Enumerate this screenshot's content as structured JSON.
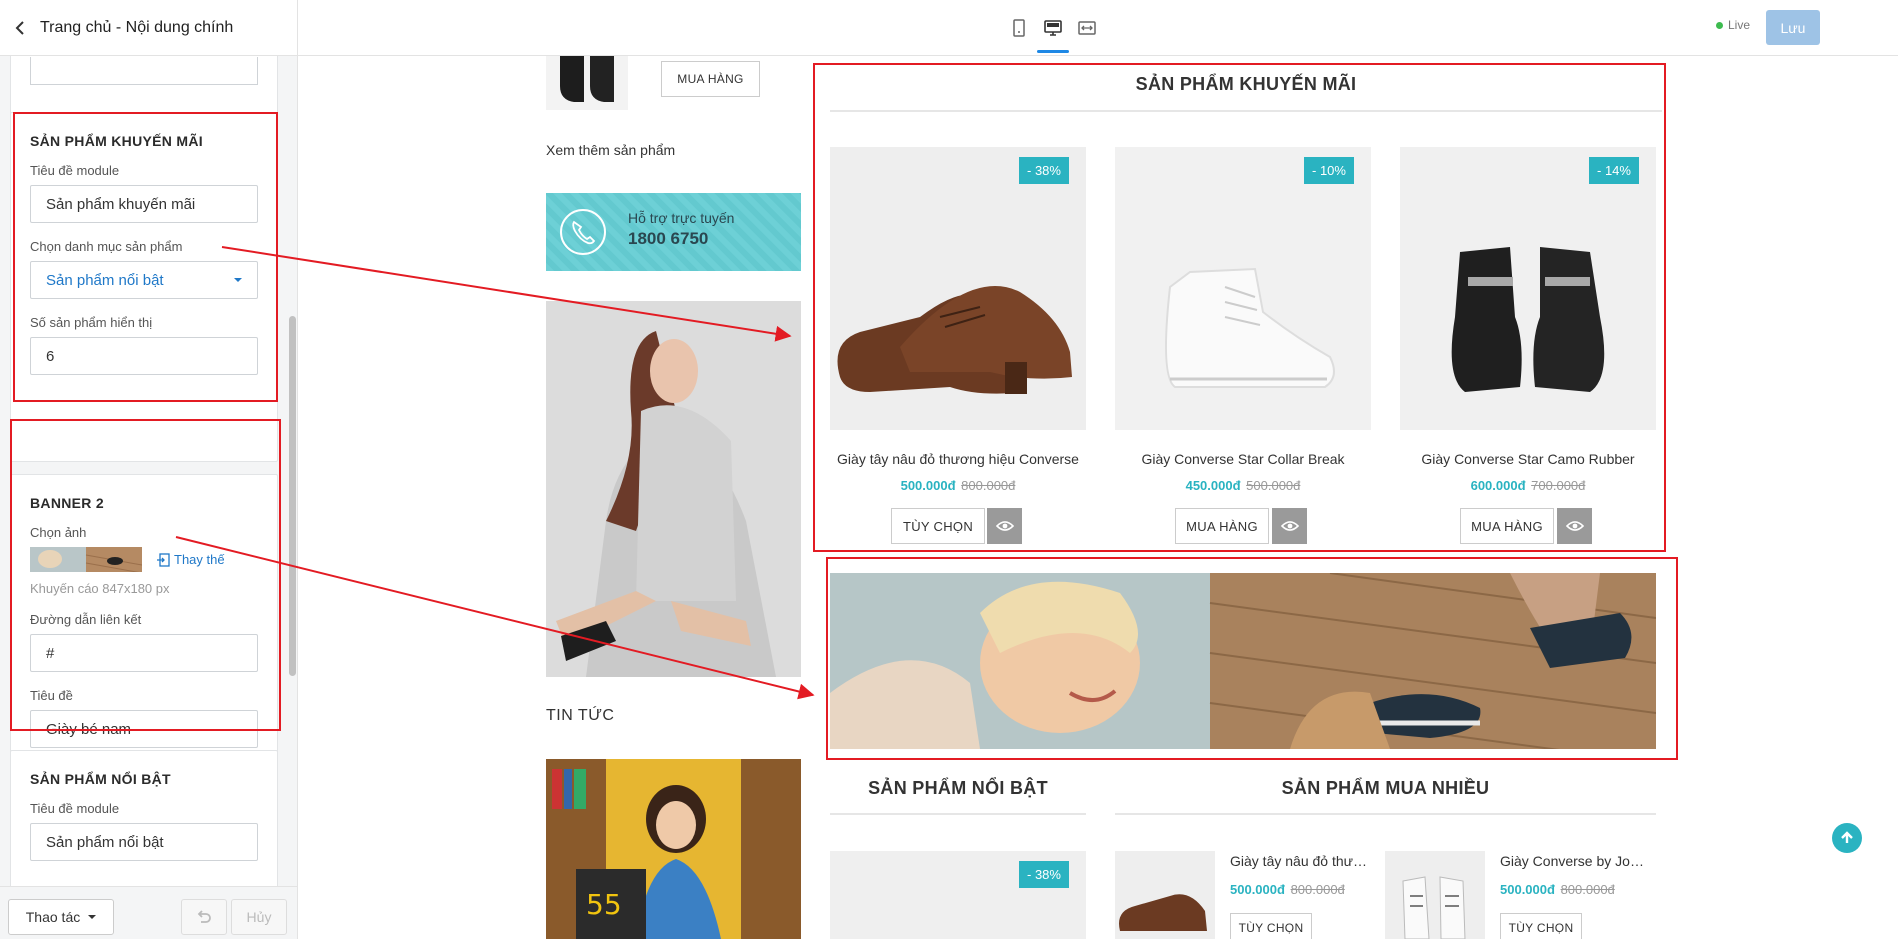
{
  "header": {
    "title": "Trang chủ - Nội dung chính",
    "live_label": "Live",
    "save_label": "Lưu"
  },
  "sidebar": {
    "promo": {
      "heading": "SẢN PHẨM KHUYẾN MÃI",
      "module_title_label": "Tiêu đề module",
      "module_title_value": "Sản phẩm khuyến mãi",
      "category_label": "Chọn danh mục sản phẩm",
      "category_value": "Sản phẩm nổi bật",
      "count_label": "Số sản phẩm hiển thị",
      "count_value": "6"
    },
    "banner": {
      "heading": "BANNER 2",
      "image_label": "Chọn ảnh",
      "replace_label": "Thay thế",
      "hint": "Khuyến cáo 847x180 px",
      "link_label": "Đường dẫn liên kết",
      "link_value": "#",
      "title_label": "Tiêu đề",
      "title_value": "Giày bé nam"
    },
    "featured": {
      "heading": "SẢN PHẨM NỔI BẬT",
      "module_title_label": "Tiêu đề module",
      "module_title_value": "Sản phẩm nổi bật"
    },
    "footer": {
      "actions_label": "Thao tác",
      "cancel_label": "Hủy"
    }
  },
  "preview": {
    "left": {
      "buy_label": "MUA HÀNG",
      "see_more": "Xem thêm sản phẩm",
      "support_label": "Hỗ trợ trực tuyến",
      "support_phone": "1800 6750",
      "news_heading": "TIN TỨC"
    },
    "promo": {
      "title": "SẢN PHẨM KHUYẾN MÃI",
      "products": [
        {
          "name": "Giày tây nâu đỏ thương hiệu Converse",
          "price": "500.000đ",
          "old_price": "800.000đ",
          "badge": "- 38%",
          "button": "TÙY CHỌN"
        },
        {
          "name": "Giày Converse Star Collar Break",
          "price": "450.000đ",
          "old_price": "500.000đ",
          "badge": "- 10%",
          "button": "MUA HÀNG"
        },
        {
          "name": "Giày Converse Star Camo Rubber",
          "price": "600.000đ",
          "old_price": "700.000đ",
          "badge": "- 14%",
          "button": "MUA HÀNG"
        }
      ]
    },
    "featured": {
      "title": "SẢN PHẨM NỔI BẬT",
      "badge": "- 38%"
    },
    "bestseller": {
      "title": "SẢN PHẨM MUA NHIỀU",
      "products": [
        {
          "name": "Giày tây nâu đỏ thương hiệu Converse",
          "price": "500.000đ",
          "old_price": "800.000đ",
          "button": "TÙY CHỌN"
        },
        {
          "name": "Giày Converse by John Varvatos",
          "price": "500.000đ",
          "old_price": "800.000đ",
          "button": "TÙY CHỌN"
        }
      ]
    }
  },
  "colors": {
    "accent": "#2ab3c1",
    "highlight_box": "#e31b23",
    "link": "#1f78c8"
  }
}
